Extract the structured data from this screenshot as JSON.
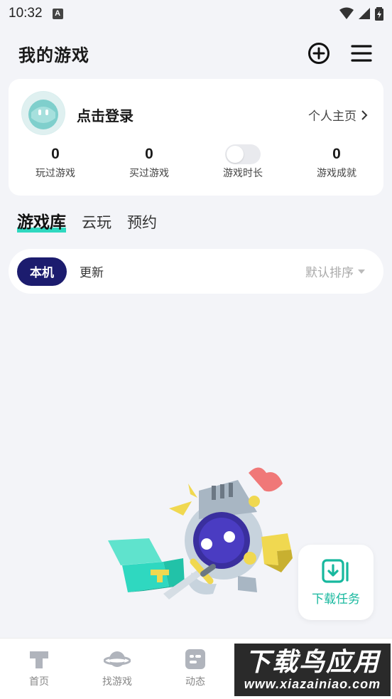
{
  "status_bar": {
    "time": "10:32",
    "notification_letter": "A"
  },
  "header": {
    "title": "我的游戏",
    "add_icon": "plus-circle-icon",
    "menu_icon": "menu-icon"
  },
  "profile": {
    "login_text": "点击登录",
    "homepage_link": "个人主页",
    "stats": [
      {
        "value": "0",
        "label": "玩过游戏"
      },
      {
        "value": "0",
        "label": "买过游戏"
      },
      {
        "value": "",
        "label": "游戏时长"
      },
      {
        "value": "0",
        "label": "游戏成就"
      }
    ]
  },
  "tabs": [
    {
      "label": "游戏库",
      "active": true
    },
    {
      "label": "云玩",
      "active": false
    },
    {
      "label": "预约",
      "active": false
    }
  ],
  "filter": {
    "active_chip": "本机",
    "chip": "更新",
    "sort_label": "默认排序"
  },
  "download_tasks": {
    "label": "下载任务",
    "icon": "download-icon"
  },
  "bottom_nav": [
    {
      "label": "首页",
      "icon": "home-icon"
    },
    {
      "label": "找游戏",
      "icon": "planet-icon"
    },
    {
      "label": "动态",
      "icon": "feed-icon"
    },
    {
      "label": "",
      "icon": ""
    },
    {
      "label": "",
      "icon": ""
    }
  ],
  "watermark": {
    "title": "下载鸟应用",
    "url": "www.xiazainiao.com"
  },
  "colors": {
    "accent": "#2fd8c0",
    "primary_dark": "#1c1c6e",
    "download_green": "#17b89e"
  }
}
